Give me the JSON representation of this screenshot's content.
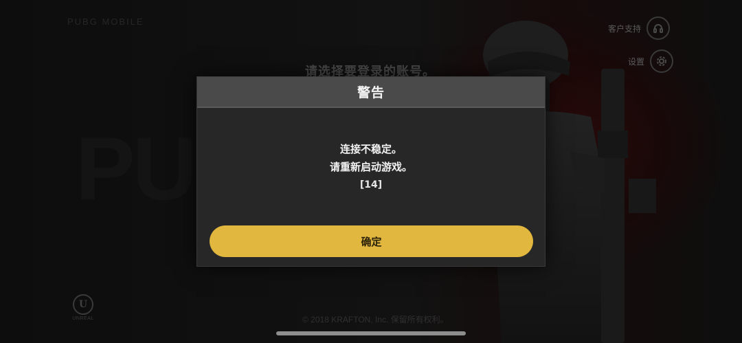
{
  "background": {
    "brand_line": "PUBG MOBILE",
    "select_account_title": "请选择要登录的账号。",
    "support_label": "客户支持",
    "support_icon": "headset-icon",
    "settings_label": "设置",
    "settings_icon": "gear-icon",
    "engine_logo_letter": "U",
    "engine_logo_word": "UNREAL",
    "copyright": "© 2018 KRAFTON, Inc. 保留所有权利。"
  },
  "dialog": {
    "title": "警告",
    "message_lines": [
      "连接不稳定。",
      "请重新启动游戏。"
    ],
    "error_code": "[14]",
    "confirm_label": "确定"
  },
  "colors": {
    "accent_button": "#e1b73f",
    "dialog_header": "#4a4a4a",
    "dialog_body": "#272727"
  }
}
